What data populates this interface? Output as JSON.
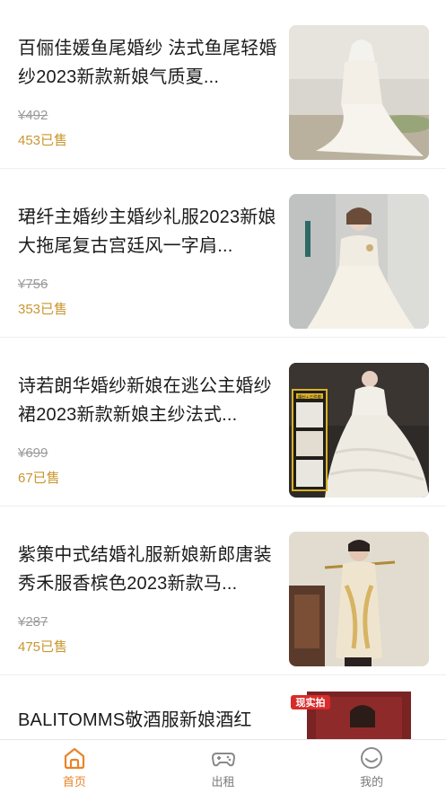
{
  "products": [
    {
      "title": "百俪佳媛鱼尾婚纱 法式鱼尾轻婚纱2023新款新娘气质夏...",
      "price": "¥492",
      "sold": "453已售"
    },
    {
      "title": "珺纤主婚纱主婚纱礼服2023新娘大拖尾复古宫廷风一字肩...",
      "price": "¥756",
      "sold": "353已售"
    },
    {
      "title": "诗若朗华婚纱新娘在逃公主婚纱裙2023新款新娘主纱法式...",
      "price": "¥699",
      "sold": "67已售"
    },
    {
      "title": "紫策中式结婚礼服新娘新郎唐装秀禾服香槟色2023新款马...",
      "price": "¥287",
      "sold": "475已售"
    },
    {
      "title": "BALITOMMS敬酒服新娘酒红"
    }
  ],
  "thumb_badges": {
    "item3_inset": "婚纱+三件套",
    "item5_stamp": "现实拍"
  },
  "tabbar": {
    "items": [
      {
        "label": "首页",
        "icon": "home-icon",
        "active": true
      },
      {
        "label": "出租",
        "icon": "gamepad-icon",
        "active": false
      },
      {
        "label": "我的",
        "icon": "smiley-face-icon",
        "active": false
      }
    ]
  },
  "colors": {
    "accent": "#e8842a",
    "sold_text": "#c9962f",
    "price_struck": "#9a9a9a",
    "title_text": "#1b1b1b"
  }
}
